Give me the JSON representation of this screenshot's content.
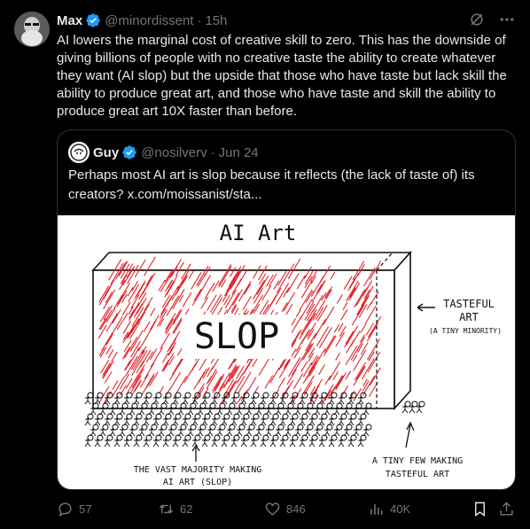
{
  "post": {
    "author_name": "Max",
    "author_handle": "@minordissent",
    "separator": "·",
    "time": "15h",
    "text": "AI lowers the marginal cost of creative skill to zero. This has the downside of giving billions of people with no creative taste the ability to create whatever they want (AI slop) but the upside that those who have taste but lack skill the ability to produce great art, and those who have taste and skill the ability to produce great art 10X faster than before."
  },
  "quote": {
    "author_name": "Guy",
    "author_handle": "@nosilverv",
    "separator": "·",
    "date": "Jun 24",
    "text": "Perhaps most AI art is slop because it reflects (the lack of taste of) its creators?  x.com/moissanist/sta..."
  },
  "image": {
    "title": "AI Art",
    "block_label": "SLOP",
    "tasteful_label_1": "TASTEFUL",
    "tasteful_label_2": "ART",
    "tasteful_label_3": "(A TINY MINORITY)",
    "majority_label_1": "THE VAST MAJORITY MAKING",
    "majority_label_2": "AI ART (SLOP)",
    "few_label_1": "A TINY FEW MAKING",
    "few_label_2": "TASTEFUL ART"
  },
  "actions": {
    "replies": "57",
    "reposts": "62",
    "likes": "846",
    "views": "40K"
  },
  "colors": {
    "verified": "#1d9bf0",
    "slop_red": "#e0242a",
    "muted": "#71767b"
  },
  "icons": [
    "verified-badge-icon",
    "grok-icon",
    "more-icon",
    "reply-icon",
    "repost-icon",
    "like-icon",
    "views-icon",
    "bookmark-icon",
    "share-icon"
  ]
}
